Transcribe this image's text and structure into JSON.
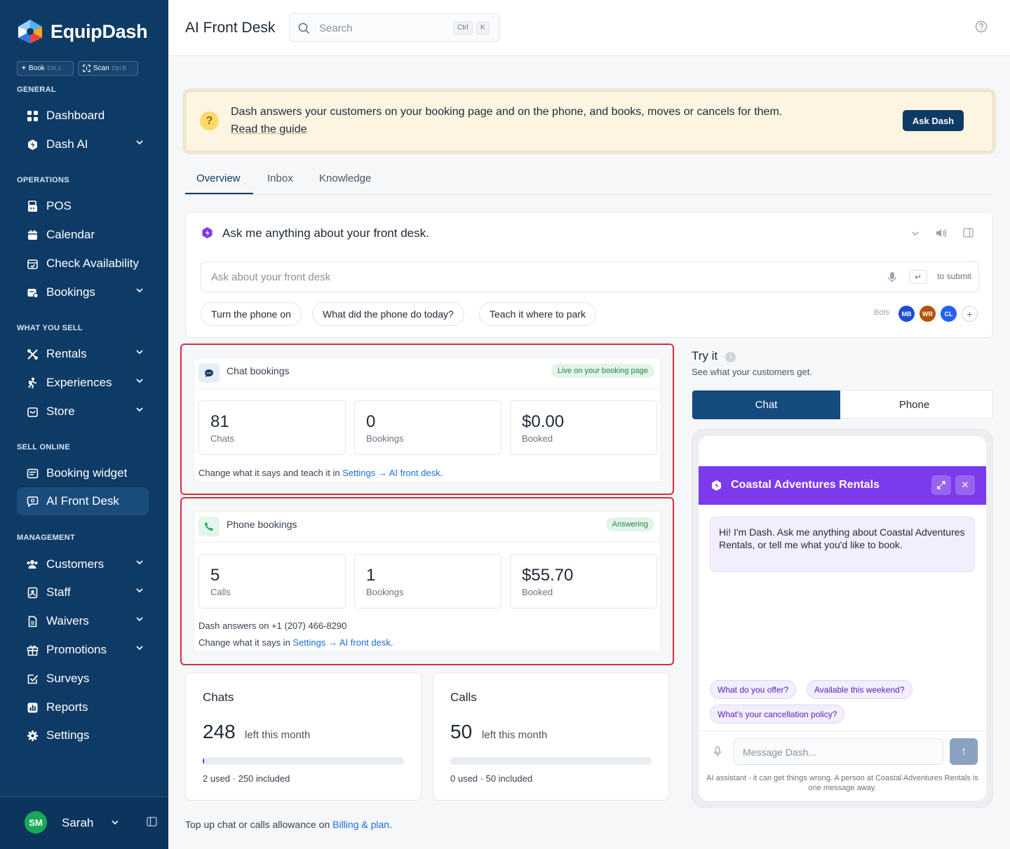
{
  "brand": {
    "name": "EquipDash",
    "colors": {
      "sidebar": "#0e3b66",
      "accent": "#1a6fd8",
      "widget": "#7c3aed",
      "alert": "#d4303d"
    }
  },
  "quick": [
    {
      "label": "Book",
      "key": "Ctrl J",
      "icon": "plus-icon"
    },
    {
      "label": "Scan",
      "key": "Ctrl B",
      "icon": "scan-icon"
    }
  ],
  "sidebar": {
    "sections": [
      "GENERAL",
      "OPERATIONS",
      "WHAT YOU SELL",
      "SELL ONLINE",
      "MANAGEMENT"
    ],
    "items": [
      {
        "label": "Dashboard",
        "icon": "grid-icon"
      },
      {
        "label": "Dash AI",
        "icon": "ai-icon"
      },
      {
        "label": "POS",
        "icon": "register-icon"
      },
      {
        "label": "Calendar",
        "icon": "calendar-icon"
      },
      {
        "label": "Check Availability",
        "icon": "calendar-check-icon"
      },
      {
        "label": "Bookings",
        "icon": "bookings-icon"
      },
      {
        "label": "Rentals",
        "icon": "rentals-icon"
      },
      {
        "label": "Experiences",
        "icon": "hiker-icon"
      },
      {
        "label": "Store",
        "icon": "bag-icon"
      },
      {
        "label": "Booking widget",
        "icon": "widget-icon"
      },
      {
        "label": "AI Front Desk",
        "icon": "chat-icon"
      },
      {
        "label": "Customers",
        "icon": "users-icon"
      },
      {
        "label": "Staff",
        "icon": "badge-icon"
      },
      {
        "label": "Waivers",
        "icon": "document-icon"
      },
      {
        "label": "Promotions",
        "icon": "gift-icon"
      },
      {
        "label": "Surveys",
        "icon": "checkbox-icon"
      },
      {
        "label": "Reports",
        "icon": "chart-icon"
      },
      {
        "label": "Settings",
        "icon": "gear-icon"
      }
    ],
    "user": {
      "initials": "SM",
      "name": "Sarah"
    }
  },
  "header": {
    "title": "AI Front Desk",
    "search_placeholder": "Search",
    "shortcut": [
      "Ctrl",
      "K"
    ]
  },
  "banner": {
    "text": "Dash answers your customers on your booking page and on the phone, and books, moves or cancels for them.",
    "link": "Read the guide",
    "button": "Ask Dash"
  },
  "tabs": [
    "Overview",
    "Inbox",
    "Knowledge"
  ],
  "ask": {
    "title": "Ask me anything about your front desk.",
    "placeholder": "Ask about your front desk",
    "submit_hint": "to submit",
    "chips": [
      "Turn the phone on",
      "What did the phone do today?",
      "Teach it where to park"
    ],
    "bots_label": "Bots",
    "bots": [
      {
        "initials": "MB",
        "color": "#1d4ed8"
      },
      {
        "initials": "WR",
        "color": "#b45309"
      },
      {
        "initials": "CL",
        "color": "#2563eb"
      }
    ]
  },
  "chat_bookings": {
    "title": "Chat bookings",
    "status": "Live on your booking page",
    "stats": [
      {
        "value": "81",
        "label": "Chats"
      },
      {
        "value": "0",
        "label": "Bookings"
      },
      {
        "value": "$0.00",
        "label": "Booked"
      }
    ],
    "note_prefix": "Change what it says and teach it in ",
    "note_link": "Settings → AI front desk",
    "note_suffix": "."
  },
  "phone_bookings": {
    "title": "Phone bookings",
    "status": "Answering",
    "stats": [
      {
        "value": "5",
        "label": "Calls"
      },
      {
        "value": "1",
        "label": "Bookings"
      },
      {
        "value": "$55.70",
        "label": "Booked"
      }
    ],
    "number_line": "Dash answers on +1 (207) 466-8290",
    "note_prefix": "Change what it says in ",
    "note_link": "Settings → AI front desk",
    "note_suffix": "."
  },
  "usage": [
    {
      "title": "Chats",
      "remaining": "248",
      "left_label": "left this month",
      "fraction_used": 0.008,
      "footer": "2 used · 250 included"
    },
    {
      "title": "Calls",
      "remaining": "50",
      "left_label": "left this month",
      "fraction_used": 0,
      "footer": "0 used · 50 included"
    }
  ],
  "topup": {
    "prefix": "Top up chat or calls allowance on ",
    "link": "Billing & plan",
    "suffix": "."
  },
  "try_it": {
    "title": "Try it",
    "subtitle": "See what your customers get.",
    "modes": [
      "Chat",
      "Phone"
    ],
    "widget": {
      "title": "Coastal Adventures Rentals",
      "greeting": "Hi! I'm Dash. Ask me anything about Coastal Adventures Rentals, or tell me what you'd like to book.",
      "suggestions": [
        "What do you offer?",
        "Available this weekend?",
        "What's your cancellation policy?"
      ],
      "input_placeholder": "Message Dash...",
      "disclaimer": "AI assistant - it can get things wrong. A person at Coastal Adventures Rentals is one message away."
    }
  }
}
